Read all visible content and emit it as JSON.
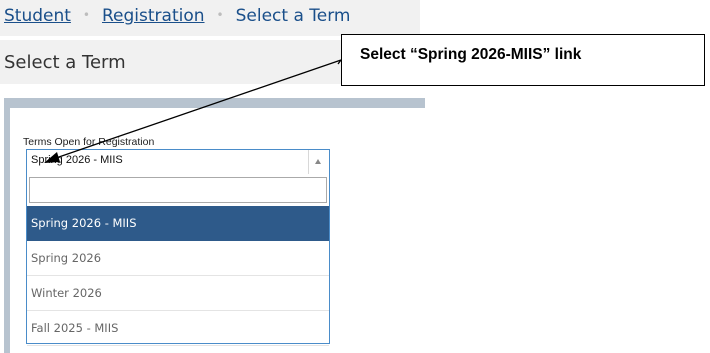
{
  "breadcrumb": {
    "items": [
      "Student",
      "Registration"
    ],
    "current": "Select a Term",
    "separator": "•"
  },
  "page": {
    "title": "Select a Term"
  },
  "callout": {
    "text": "Select “Spring 2026-MIIS” link"
  },
  "form": {
    "label": "Terms Open for Registration",
    "selected_value": "Spring 2026 - MIIS",
    "search_value": "",
    "options": [
      "Spring 2026 - MIIS",
      "Spring 2026",
      "Winter 2026",
      "Fall 2025 - MIIS"
    ]
  },
  "icons": {
    "caret": "caret-up-icon",
    "search": "search-icon"
  },
  "colors": {
    "link": "#1a4f8a",
    "selected_option_bg": "#2e5a8a",
    "panel_bg": "#b7c3cf",
    "select_border": "#4a8cc9"
  }
}
